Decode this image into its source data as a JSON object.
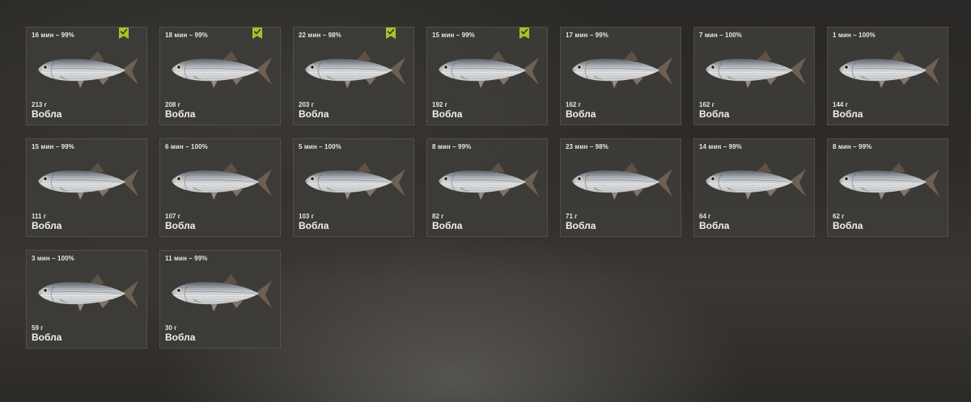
{
  "catch_list": {
    "cards": [
      {
        "info": "16 мин – 99%",
        "weight": "213 г",
        "name": "Вобла",
        "checked": true
      },
      {
        "info": "18 мин – 99%",
        "weight": "208 г",
        "name": "Вобла",
        "checked": true
      },
      {
        "info": "22 мин – 98%",
        "weight": "203 г",
        "name": "Вобла",
        "checked": true
      },
      {
        "info": "15 мин – 99%",
        "weight": "192 г",
        "name": "Вобла",
        "checked": true
      },
      {
        "info": "17 мин – 99%",
        "weight": "162 г",
        "name": "Вобла",
        "checked": false
      },
      {
        "info": "7 мин – 100%",
        "weight": "162 г",
        "name": "Вобла",
        "checked": false
      },
      {
        "info": "1 мин – 100%",
        "weight": "144 г",
        "name": "Вобла",
        "checked": false
      },
      {
        "info": "15 мин – 99%",
        "weight": "111 г",
        "name": "Вобла",
        "checked": false
      },
      {
        "info": "6 мин – 100%",
        "weight": "107 г",
        "name": "Вобла",
        "checked": false
      },
      {
        "info": "5 мин – 100%",
        "weight": "103 г",
        "name": "Вобла",
        "checked": false
      },
      {
        "info": "8 мин – 99%",
        "weight": "82 г",
        "name": "Вобла",
        "checked": false
      },
      {
        "info": "23 мин – 98%",
        "weight": "71 г",
        "name": "Вобла",
        "checked": false
      },
      {
        "info": "14 мин – 99%",
        "weight": "64 г",
        "name": "Вобла",
        "checked": false
      },
      {
        "info": "8 мин – 99%",
        "weight": "62 г",
        "name": "Вобла",
        "checked": false
      },
      {
        "info": "3 мин – 100%",
        "weight": "59 г",
        "name": "Вобла",
        "checked": false
      },
      {
        "info": "11 мин – 99%",
        "weight": "30 г",
        "name": "Вобла",
        "checked": false
      }
    ]
  },
  "icons": {
    "check": "check-badge-icon",
    "fish": "roach-fish-icon"
  },
  "colors": {
    "check_badge": "#a6c22e",
    "card_bg": "#3e3c39",
    "text": "#e8e6e0"
  }
}
